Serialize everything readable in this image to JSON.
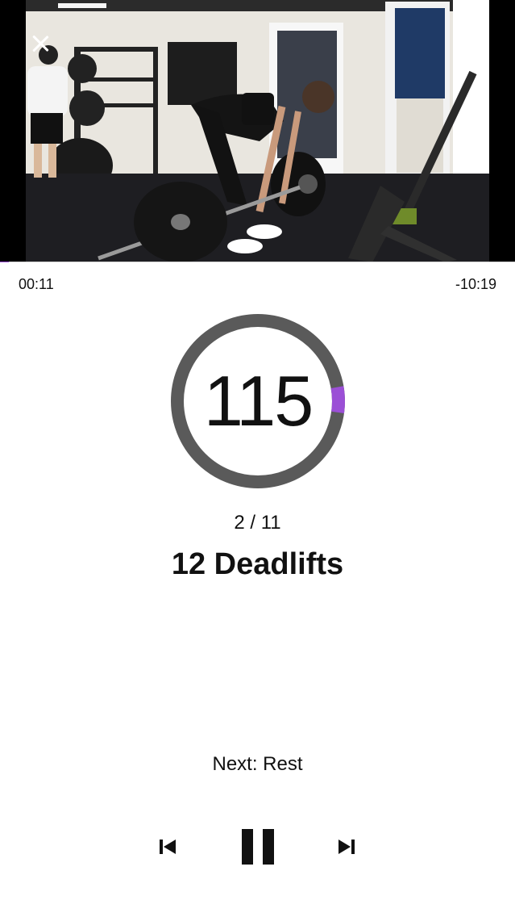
{
  "player": {
    "elapsed": "00:11",
    "remaining": "-10:19",
    "progress_fraction": 0.017
  },
  "timer": {
    "value": "115",
    "ring_fraction": 0.05,
    "ring_color": "#9b4fd6",
    "track_color": "#5a5a5a"
  },
  "workout": {
    "counter": "2 / 11",
    "exercise": "12 Deadlifts",
    "next": "Next: Rest"
  },
  "icons": {
    "close": "close-icon",
    "cast": "circle-icon",
    "previous": "skip-previous-icon",
    "pause": "pause-icon",
    "next": "skip-next-icon"
  },
  "colors": {
    "accent": "#9b4fd6",
    "text": "#111111",
    "background": "#ffffff"
  }
}
